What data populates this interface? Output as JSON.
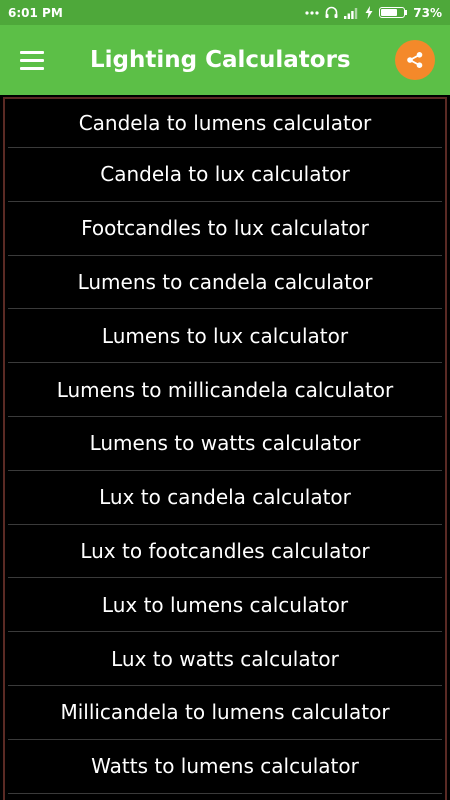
{
  "status_bar": {
    "time": "6:01 PM",
    "battery_percent": "73%",
    "battery_level": 0.73
  },
  "app_bar": {
    "title": "Lighting Calculators",
    "menu_icon": "hamburger-menu-icon",
    "share_icon": "share-icon"
  },
  "colors": {
    "status_bar": "#4ea83a",
    "app_bar": "#5cbf47",
    "share_button": "#f4892a",
    "background": "#000000",
    "divider": "#3a3a3a",
    "frame": "#5a2a24"
  },
  "calculators": [
    "Candela to lumens calculator",
    "Candela to lux calculator",
    "Footcandles to lux calculator",
    "Lumens to candela calculator",
    "Lumens to lux calculator",
    "Lumens to millicandela calculator",
    "Lumens to watts calculator",
    "Lux to candela calculator",
    "Lux to footcandles calculator",
    "Lux to lumens calculator",
    "Lux to watts calculator",
    "Millicandela to lumens calculator",
    "Watts to lumens calculator"
  ]
}
